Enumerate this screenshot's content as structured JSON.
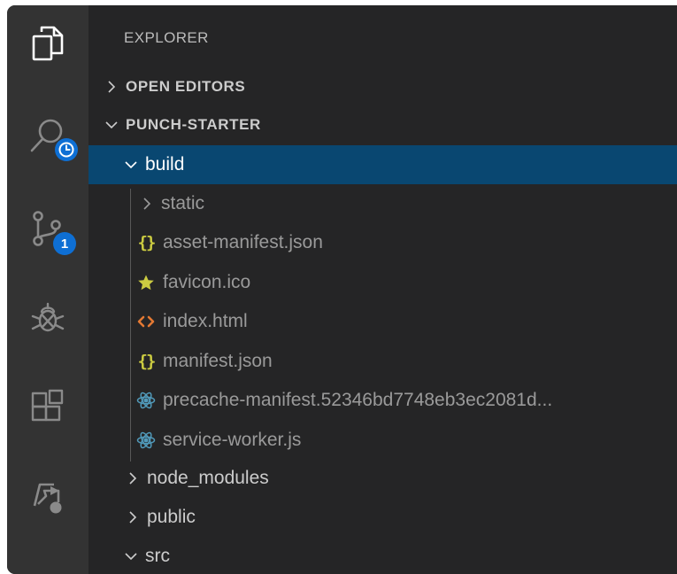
{
  "sidebar": {
    "title": "EXPLORER",
    "sections": {
      "open_editors": "OPEN EDITORS",
      "project": "PUNCH-STARTER"
    }
  },
  "activity_bar": {
    "items": [
      {
        "name": "files-icon"
      },
      {
        "name": "search-icon",
        "overlay": "clock-badge-icon"
      },
      {
        "name": "source-control-icon",
        "badge": "1"
      },
      {
        "name": "debug-icon"
      },
      {
        "name": "extensions-icon"
      },
      {
        "name": "live-share-icon"
      }
    ]
  },
  "tree": {
    "build": "build",
    "static": "static",
    "asset_manifest": "asset-manifest.json",
    "favicon": "favicon.ico",
    "index_html": "index.html",
    "manifest": "manifest.json",
    "precache": "precache-manifest.52346bd7748eb3ec2081d...",
    "service_worker": "service-worker.js",
    "node_modules": "node_modules",
    "public": "public",
    "src": "src"
  },
  "colors": {
    "activity_bar": "#333333",
    "sidebar": "#252526",
    "selection": "#094771",
    "badge": "#0e6fd4",
    "json_icon": "#cbcb41",
    "html_icon": "#e37933",
    "star_icon": "#cbcb41",
    "react_icon": "#519aba"
  }
}
